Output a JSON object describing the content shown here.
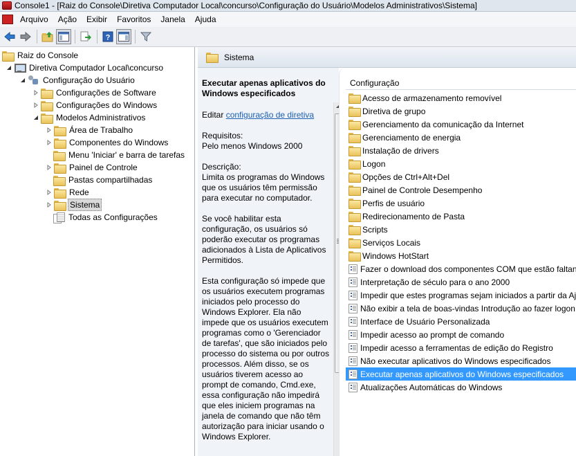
{
  "window": {
    "title": "Console1 - [Raiz do Console\\Diretiva Computador Local\\concurso\\Configuração do Usuário\\Modelos Administrativos\\Sistema]"
  },
  "menu": {
    "items": [
      "Arquivo",
      "Ação",
      "Exibir",
      "Favoritos",
      "Janela",
      "Ajuda"
    ]
  },
  "toolbar": {
    "buttons": [
      "back-icon",
      "forward-icon",
      "up-folder-icon",
      "show-hide-tree-icon",
      "export-list-icon",
      "help-icon",
      "show-hide-action-pane-icon",
      "filter-icon"
    ]
  },
  "tree": {
    "items": [
      {
        "label": "Raiz do Console"
      },
      {
        "label": "Diretiva Computador Local\\concurso"
      },
      {
        "label": "Configuração do Usuário"
      },
      {
        "label": "Configurações de Software"
      },
      {
        "label": "Configurações do Windows"
      },
      {
        "label": "Modelos Administrativos"
      },
      {
        "label": "Área de Trabalho"
      },
      {
        "label": "Componentes do Windows"
      },
      {
        "label": "Menu 'Iniciar' e barra de tarefas"
      },
      {
        "label": "Painel de Controle"
      },
      {
        "label": "Pastas compartilhadas"
      },
      {
        "label": "Rede"
      },
      {
        "label": "Sistema"
      },
      {
        "label": "Todas as Configurações"
      }
    ]
  },
  "header": {
    "title": "Sistema"
  },
  "description": {
    "title": "Executar apenas aplicativos do Windows especificados",
    "edit_prefix": "Editar ",
    "edit_link": "configuração de diretiva",
    "requirements_label": "Requisitos:",
    "requirements": "Pelo menos Windows 2000",
    "description_label": "Descrição:",
    "p1": "Limita os programas do Windows que os usuários têm permissão para executar no computador.",
    "p2": "Se você habilitar esta configuração, os usuários só poderão executar os programas adicionados à Lista de Aplicativos Permitidos.",
    "p3": "Esta configuração só impede que os usuários executem programas iniciados pelo processo do Windows Explorer. Ela não impede que os usuários executem programas como o 'Gerenciador de tarefas', que são iniciados pelo processo do sistema ou por outros processos. Além disso, se os usuários tiverem acesso ao prompt de comando, Cmd.exe, essa configuração não impedirá que eles iniciem programas na janela de comando que não têm autorização para iniciar usando o Windows Explorer."
  },
  "list": {
    "column_header": "Configuração",
    "items": [
      {
        "label": "Acesso de armazenamento removível",
        "kind": "folder"
      },
      {
        "label": "Diretiva de grupo",
        "kind": "folder"
      },
      {
        "label": "Gerenciamento da comunicação da Internet",
        "kind": "folder"
      },
      {
        "label": "Gerenciamento de energia",
        "kind": "folder"
      },
      {
        "label": "Instalação de drivers",
        "kind": "folder"
      },
      {
        "label": "Logon",
        "kind": "folder"
      },
      {
        "label": "Opções de Ctrl+Alt+Del",
        "kind": "folder"
      },
      {
        "label": "Painel de Controle Desempenho",
        "kind": "folder"
      },
      {
        "label": "Perfis de usuário",
        "kind": "folder"
      },
      {
        "label": "Redirecionamento de Pasta",
        "kind": "folder"
      },
      {
        "label": "Scripts",
        "kind": "folder"
      },
      {
        "label": "Serviços Locais",
        "kind": "folder"
      },
      {
        "label": "Windows HotStart",
        "kind": "folder"
      },
      {
        "label": "Fazer o download dos componentes COM que estão faltan",
        "kind": "policy"
      },
      {
        "label": "Interpretação de século para o ano 2000",
        "kind": "policy"
      },
      {
        "label": "Impedir que estes programas sejam iniciados a partir da Aj",
        "kind": "policy"
      },
      {
        "label": "Não exibir a tela de boas-vindas Introdução ao fazer logon",
        "kind": "policy"
      },
      {
        "label": "Interface de Usuário Personalizada",
        "kind": "policy"
      },
      {
        "label": "Impedir acesso ao prompt de comando",
        "kind": "policy"
      },
      {
        "label": "Impedir acesso a ferramentas de edição do Registro",
        "kind": "policy"
      },
      {
        "label": "Não executar aplicativos do Windows especificados",
        "kind": "policy"
      },
      {
        "label": "Executar apenas aplicativos do Windows especificados",
        "kind": "policy",
        "selected": true
      },
      {
        "label": "Atualizações Automáticas do Windows",
        "kind": "policy"
      }
    ]
  },
  "colors": {
    "selection": "#3399ff",
    "link": "#1b5fb5"
  }
}
